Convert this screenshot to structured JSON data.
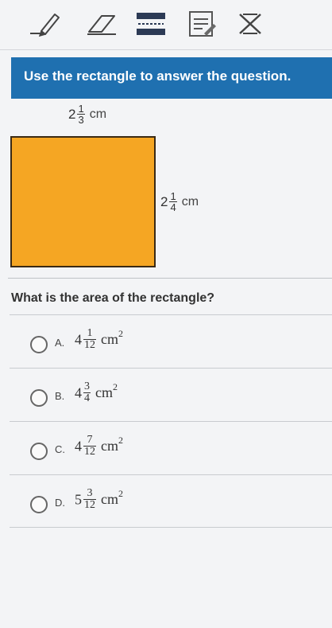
{
  "toolbar": {
    "tools": [
      {
        "name": "pencil-icon"
      },
      {
        "name": "eraser-icon"
      },
      {
        "name": "line-reader-icon"
      },
      {
        "name": "notepad-icon"
      },
      {
        "name": "answer-eliminator-icon"
      }
    ]
  },
  "prompt": {
    "instruction": "Use the rectangle to answer the question."
  },
  "figure": {
    "width": {
      "whole": "2",
      "num": "1",
      "den": "3",
      "unit": "cm"
    },
    "height": {
      "whole": "2",
      "num": "1",
      "den": "4",
      "unit": "cm"
    },
    "fill_color": "#f5a623"
  },
  "question": "What is the area of the rectangle?",
  "options": [
    {
      "letter": "A.",
      "whole": "4",
      "num": "1",
      "den": "12",
      "unit": "cm",
      "exp": "2"
    },
    {
      "letter": "B.",
      "whole": "4",
      "num": "3",
      "den": "4",
      "unit": "cm",
      "exp": "2"
    },
    {
      "letter": "C.",
      "whole": "4",
      "num": "7",
      "den": "12",
      "unit": "cm",
      "exp": "2"
    },
    {
      "letter": "D.",
      "whole": "5",
      "num": "3",
      "den": "12",
      "unit": "cm",
      "exp": "2"
    }
  ],
  "colors": {
    "banner": "#1f70b0",
    "rectangle": "#f5a623"
  }
}
